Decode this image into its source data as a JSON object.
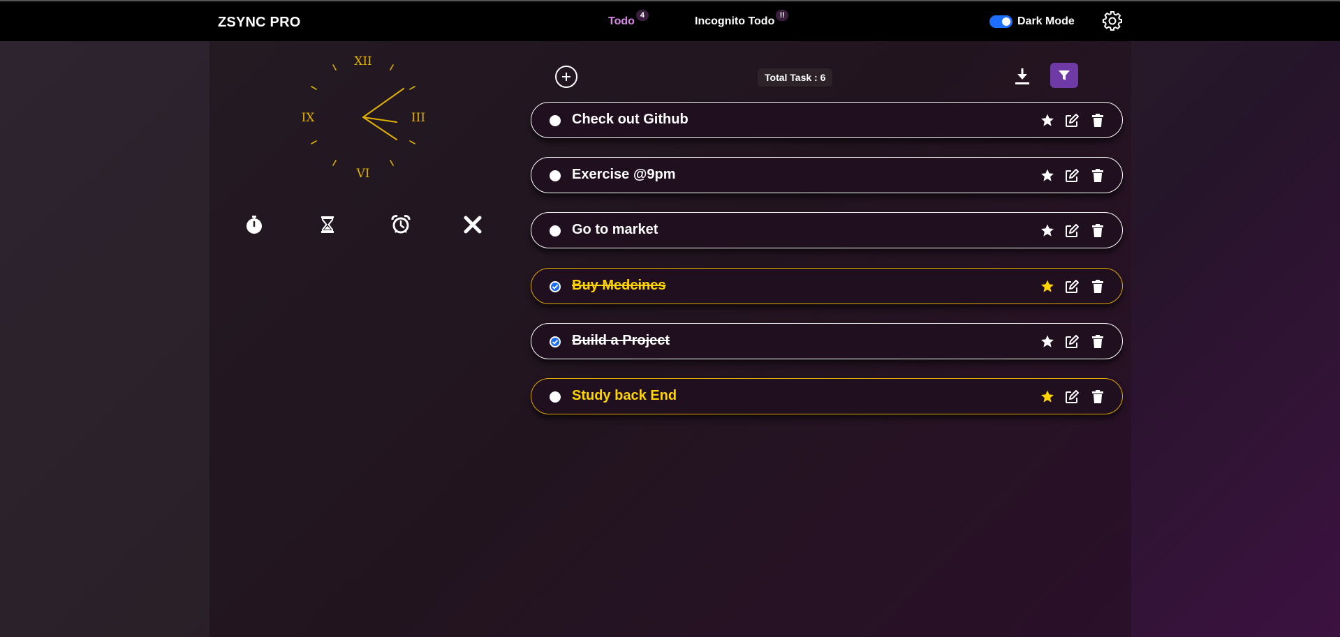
{
  "navbar": {
    "brand": "ZSYNC PRO",
    "tabs": [
      {
        "label": "Todo",
        "badge": "4",
        "active": true
      },
      {
        "label": "Incognito Todo",
        "badge": "!!"
      }
    ],
    "dark_mode_label": "Dark Mode",
    "dark_mode_on": true,
    "settings_icon": "gear-icon"
  },
  "clock": {
    "numerals": {
      "top": "XII",
      "right": "III",
      "bottom": "VI",
      "left": "IX"
    },
    "color": "#e0b100"
  },
  "tools": [
    "stopwatch-icon",
    "hourglass-icon",
    "alarm-clock-icon",
    "close-icon"
  ],
  "toolbar": {
    "total_task": "Total Task : 6",
    "add_icon": "plus-circle-icon",
    "download_icon": "download-icon",
    "filter_icon": "filter-icon"
  },
  "tasks": [
    {
      "text": "Check out Github",
      "done": false,
      "favorite": false
    },
    {
      "text": "Exercise @9pm",
      "done": false,
      "favorite": false
    },
    {
      "text": "Go to market",
      "done": false,
      "favorite": false
    },
    {
      "text": "Buy Medcines",
      "done": true,
      "favorite": true
    },
    {
      "text": "Build a Project",
      "done": true,
      "favorite": false
    },
    {
      "text": "Study back End",
      "done": false,
      "favorite": true
    }
  ],
  "colors": {
    "accent": "#6f3aa6",
    "favorite": "#ffd400",
    "toggle": "#1e6fff",
    "active_tab": "#d98ae6"
  }
}
